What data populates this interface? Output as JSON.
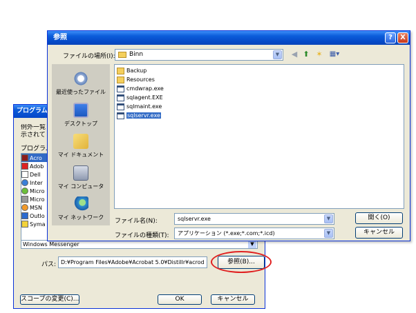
{
  "background_dialog": {
    "title": "プログラムの",
    "intro_text": "例外一覧\n示されて",
    "programs_label": "プログラム",
    "programs": [
      {
        "label": "Acro",
        "selected": true,
        "icon": "acrobat-icon"
      },
      {
        "label": "Adob",
        "selected": false,
        "icon": "adobe-icon"
      },
      {
        "label": "Dell",
        "selected": false,
        "icon": "window-icon"
      },
      {
        "label": "Inter",
        "selected": false,
        "icon": "ie-icon"
      },
      {
        "label": "Micro",
        "selected": false,
        "icon": "msn-icon"
      },
      {
        "label": "Micro",
        "selected": false,
        "icon": "msn-icon"
      },
      {
        "label": "MSN",
        "selected": false,
        "icon": "msn-icon"
      },
      {
        "label": "Outlo",
        "selected": false,
        "icon": "outlook-icon"
      },
      {
        "label": "Syma",
        "selected": false,
        "icon": "symantec-icon"
      },
      {
        "label": "Windows Messenger",
        "selected": false,
        "icon": "messenger-icon"
      }
    ],
    "path_label": "パス:",
    "path_value": "D:¥Program Files¥Adobe¥Acrobat 5.0¥Distillr¥acrod",
    "browse_button": "参照(B)...",
    "scope_button": "スコープの変更(C)...",
    "ok_button": "OK",
    "cancel_button": "キャンセル"
  },
  "file_dialog": {
    "title": "参照",
    "help_button": "?",
    "close_button": "X",
    "look_in_label": "ファイルの場所(I):",
    "look_in_value": "Binn",
    "places": [
      {
        "label": "最近使ったファイル",
        "icon": "recent-files-icon"
      },
      {
        "label": "デスクトップ",
        "icon": "desktop-icon"
      },
      {
        "label": "マイ ドキュメント",
        "icon": "my-documents-icon"
      },
      {
        "label": "マイ コンピュータ",
        "icon": "my-computer-icon"
      },
      {
        "label": "マイ ネットワーク",
        "icon": "my-network-icon"
      }
    ],
    "files": [
      {
        "name": "Backup",
        "type": "folder",
        "selected": false
      },
      {
        "name": "Resources",
        "type": "folder",
        "selected": false
      },
      {
        "name": "cmdwrap.exe",
        "type": "exe",
        "selected": false
      },
      {
        "name": "sqlagent.EXE",
        "type": "exe",
        "selected": false
      },
      {
        "name": "sqlmaint.exe",
        "type": "exe",
        "selected": false
      },
      {
        "name": "sqlservr.exe",
        "type": "exe",
        "selected": true
      }
    ],
    "file_name_label": "ファイル名(N):",
    "file_name_value": "sqlservr.exe",
    "file_type_label": "ファイルの種類(T):",
    "file_type_value": "アプリケーション (*.exe;*.com;*.icd)",
    "open_button": "開く(O)",
    "cancel_button": "キャンセル"
  },
  "colors": {
    "titlebar": "#0a5ad8",
    "dialog_bg": "#ece9d8",
    "selection": "#316ac5",
    "highlight_oval": "#e02020"
  }
}
